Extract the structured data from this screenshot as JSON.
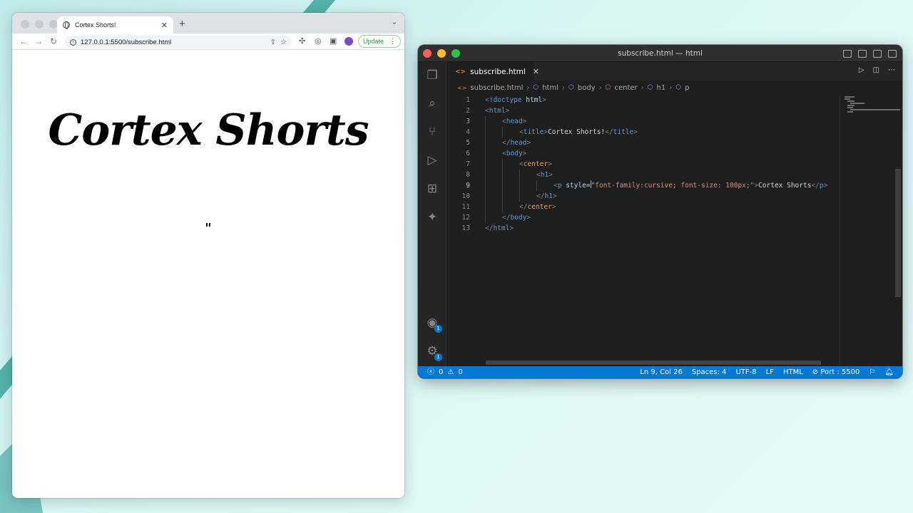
{
  "browser": {
    "tab_title": "Cortex Shorts!",
    "new_tab_label": "+",
    "url": "127.0.0.1:5500/subscribe.html",
    "update_label": "Update",
    "page": {
      "heading": "Cortex Shorts",
      "quote_mark": "\""
    }
  },
  "vscode": {
    "window_title": "subscribe.html — html",
    "tab_label": "subscribe.html",
    "breadcrumbs": [
      "subscribe.html",
      "html",
      "body",
      "center",
      "h1",
      "p"
    ],
    "code_lines": [
      {
        "n": "1",
        "text": "<!doctype html>"
      },
      {
        "n": "2",
        "text": "<html>"
      },
      {
        "n": "3",
        "text": "<head>"
      },
      {
        "n": "4",
        "text": "<title>Cortex Shorts!</title>"
      },
      {
        "n": "5",
        "text": "</head>"
      },
      {
        "n": "6",
        "text": "<body>"
      },
      {
        "n": "7",
        "text": "<center>"
      },
      {
        "n": "8",
        "text": "<h1>"
      },
      {
        "n": "9",
        "text": "<p style=\"font-family:cursive; font-size: 100px;\">Cortex Shorts</p>"
      },
      {
        "n": "10",
        "text": "</h1>"
      },
      {
        "n": "11",
        "text": "</center>"
      },
      {
        "n": "12",
        "text": "</body>"
      },
      {
        "n": "13",
        "text": "</html>"
      }
    ],
    "status": {
      "errors": "0",
      "warnings": "0",
      "position": "Ln 9, Col 26",
      "spaces": "Spaces: 4",
      "encoding": "UTF-8",
      "eol": "LF",
      "language": "HTML",
      "port": "Port : 5500"
    },
    "badges": {
      "accounts": "1",
      "manage": "1"
    }
  },
  "colors": {
    "statusbar": "#0078d4",
    "editor_bg": "#1e1e1e",
    "tag": "#569cd6",
    "string": "#ce9178",
    "attribute": "#9cdcfe"
  }
}
